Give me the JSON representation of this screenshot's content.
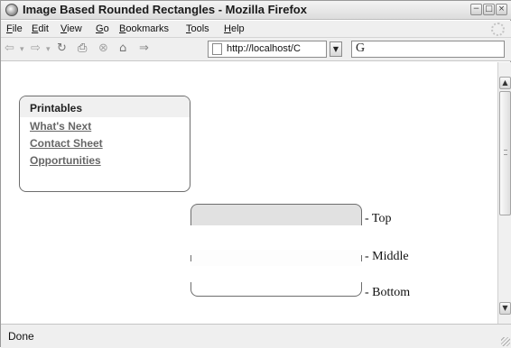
{
  "window": {
    "title": "Image Based Rounded Rectangles - Mozilla Firefox",
    "controls": [
      "−",
      "□",
      "×"
    ]
  },
  "menubar": {
    "items": [
      {
        "key": "F",
        "rest": "ile"
      },
      {
        "key": "E",
        "rest": "dit"
      },
      {
        "key": "V",
        "rest": "iew"
      },
      {
        "key": "G",
        "rest": "o"
      },
      {
        "key": "B",
        "rest": "ookmarks"
      },
      {
        "key": "T",
        "rest": "ools"
      },
      {
        "key": "H",
        "rest": "elp"
      }
    ]
  },
  "toolbar": {
    "back_icon": "⇦",
    "back_drop": "▾",
    "forward_icon": "⇨",
    "forward_drop": "▾",
    "reload_icon": "↻",
    "print_icon": "⎙",
    "stop_icon": "⊗",
    "home_icon": "⌂",
    "go_icon": "⇒",
    "url": "http://localhost/C",
    "url_dropdown_icon": "▼",
    "search_engine": "G"
  },
  "sidebar_box": {
    "heading": "Printables",
    "links": [
      "What's Next",
      "Contact Sheet",
      "Opportunities"
    ]
  },
  "demo": {
    "top_label": "- Top",
    "middle_label": "- Middle",
    "bottom_label": "- Bottom"
  },
  "scrollbar": {
    "up_icon": "▲",
    "down_icon": "▼"
  },
  "statusbar": {
    "text": "Done"
  }
}
